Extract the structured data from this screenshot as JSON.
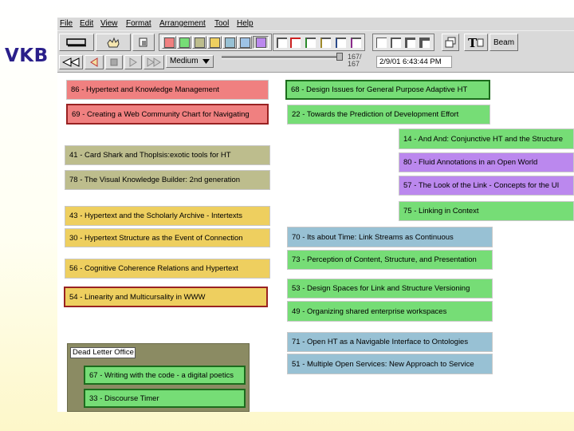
{
  "slide": {
    "title": "VKB"
  },
  "menu": [
    "File",
    "Edit",
    "View",
    "Format",
    "Arrangement",
    "Tool",
    "Help"
  ],
  "toolbar": {
    "swatches": [
      "#f08080",
      "#76dd76",
      "#bdbd8d",
      "#eecf5f",
      "#98c1d4",
      "#9ec3e6",
      "#bb88ee"
    ],
    "beam_label": "Beam",
    "zoom_value": "Medium",
    "counter_top": "167/",
    "counter_bottom": "167",
    "timestamp": "2/9/01 6:43:44 PM"
  },
  "nodes": [
    {
      "text": "86 - Hypertext and Knowledge Management",
      "color": "pink"
    },
    {
      "text": "68 - Design Issues for General Purpose Adaptive HT",
      "color": "green"
    },
    {
      "text": "69 - Creating a Web Community Chart for Navigating",
      "color": "pink"
    },
    {
      "text": "22 - Towards the Prediction of Development Effort",
      "color": "green"
    },
    {
      "text": "14 - And And: Conjunctive HT and the Structure",
      "color": "green"
    },
    {
      "text": "41 - Card Shark and Thoplsis:exotic tools for HT",
      "color": "khaki"
    },
    {
      "text": "80 - Fluid Annotations in an Open World",
      "color": "purple"
    },
    {
      "text": "78 - The Visual Knowledge Builder: 2nd generation",
      "color": "khaki"
    },
    {
      "text": "57 - The Look of the Link - Concepts for the UI",
      "color": "purple"
    },
    {
      "text": "75 - Linking in Context",
      "color": "green"
    },
    {
      "text": "43 - Hypertext and the Scholarly Archive - Intertexts",
      "color": "yellow"
    },
    {
      "text": "70 - Its about Time: Link Streams as Continuous",
      "color": "blue"
    },
    {
      "text": "30 - Hypertext Structure as the Event of Connection",
      "color": "yellow"
    },
    {
      "text": "73 - Perception of Content, Structure, and Presentation",
      "color": "green"
    },
    {
      "text": "56 - Cognitive Coherence Relations and Hypertext",
      "color": "yellow"
    },
    {
      "text": "53 - Design Spaces for Link and Structure Versioning",
      "color": "green"
    },
    {
      "text": "54 - Linearity and Multicursality in WWW",
      "color": "yellow"
    },
    {
      "text": "49 - Organizing shared enterprise workspaces",
      "color": "green"
    },
    {
      "text": "71 - Open HT as a Navigable Interface to Ontologies",
      "color": "blue"
    },
    {
      "text": "51 - Multiple Open Services: New Approach to Service",
      "color": "blue"
    }
  ],
  "collection": {
    "title": "Dead Letter Office",
    "items": [
      {
        "text": "67 - Writing with the code - a digital poetics",
        "color": "green"
      },
      {
        "text": "33 - Discourse Timer",
        "color": "green"
      }
    ]
  }
}
